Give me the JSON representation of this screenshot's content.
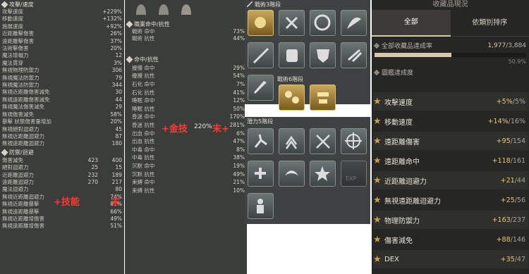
{
  "panel1": {
    "section_title": "攻擊/速度",
    "rows": [
      {
        "label": "攻擊速度",
        "value": "+229%"
      },
      {
        "label": "移動速度",
        "value": "+132%"
      },
      {
        "label": "施展速度",
        "value": "+92%"
      },
      {
        "label": "近距離擊傷害",
        "value": "26%"
      },
      {
        "label": "遠距離擊傷害",
        "value": "37%"
      },
      {
        "label": "法術擊傷害",
        "value": "20%"
      },
      {
        "label": "魔法增幅力",
        "value": "12"
      },
      {
        "label": "魔法貫穿",
        "value": "3%"
      },
      {
        "label": "無視物理防禦力",
        "value": "306"
      },
      {
        "label": "無視魔法防禦力",
        "value": "79"
      },
      {
        "label": "無視魔法防禦力",
        "value": "344"
      },
      {
        "label": "無視近距離傷害減免",
        "value": "30"
      },
      {
        "label": "無視遠距離傷害減免",
        "value": "44"
      },
      {
        "label": "無視魔法傷害減免",
        "value": "29"
      },
      {
        "label": "無視傷害減免",
        "value": "58%"
      },
      {
        "label": "暴擊 狀態傷害量增加",
        "value": "20%"
      },
      {
        "label": "無視絕對迴避力",
        "value": "45"
      },
      {
        "label": "無視近距離迴避力",
        "value": "87"
      },
      {
        "label": "無視遠距離迴避力",
        "value": "180"
      }
    ],
    "section2_title": "防禦/迴避",
    "rows2": [
      {
        "label": "傷害減免",
        "a": "423",
        "b": "400"
      },
      {
        "label": "絕對迴避力",
        "a": "25",
        "b": "15"
      },
      {
        "label": "近距離迴避力",
        "a": "232",
        "b": "189"
      },
      {
        "label": "遠距離迴避力",
        "a": "270",
        "b": "217"
      },
      {
        "label": "魔法迴避力",
        "a": "",
        "b": "80"
      },
      {
        "label": "無視近距離迴避力",
        "a": "",
        "b": "74%"
      },
      {
        "label": "無視近距離暴擊",
        "a": "",
        "b": "81%"
      },
      {
        "label": "無視遠距離暴擊",
        "a": "",
        "b": "66%"
      },
      {
        "label": "無視近距離增傷害",
        "a": "",
        "b": "49%"
      },
      {
        "label": "無視遠距離增傷害",
        "a": "",
        "b": "51%"
      }
    ],
    "red_label": "+技能",
    "red_end": "末"
  },
  "panel2": {
    "section_title": "職業命中/抗性",
    "rows": [
      {
        "label": "戰術 命中",
        "value": "73%"
      },
      {
        "label": "戰術 抗性",
        "value": "44%"
      }
    ],
    "section2_title": "命中/抗性",
    "rows2": [
      {
        "label": "擾攪 命中",
        "value": "29%"
      },
      {
        "label": "擾攪 抗性",
        "value": "54%"
      },
      {
        "label": "石化 命中",
        "value": "7%"
      },
      {
        "label": "石化 抗性",
        "value": "41%"
      },
      {
        "label": "睡眠 命中",
        "value": "12%"
      },
      {
        "label": "睡眠 抗性",
        "value": "50%"
      },
      {
        "label": "昏迷 命中",
        "value": "170%"
      },
      {
        "label": "昏迷 抗性",
        "value": "281%"
      },
      {
        "label": "出血 命中",
        "value": "6%"
      },
      {
        "label": "出血 抗性",
        "value": "47%"
      },
      {
        "label": "中毒 命中",
        "value": "8%"
      },
      {
        "label": "中毒 抗性",
        "value": "38%"
      },
      {
        "label": "沉默 命中",
        "value": "19%"
      },
      {
        "label": "沉默 抗性",
        "value": "49%"
      },
      {
        "label": "束縛 命中",
        "value": "21%"
      },
      {
        "label": "束縛 抗性",
        "value": "10%"
      }
    ],
    "red_label": "+金技",
    "red_pct": "220%",
    "red_end": "末+"
  },
  "panel3": {
    "title1": "戰術3階段",
    "title2": "戰術6階段",
    "title3": "潛力5階段",
    "exp_label": "EXP"
  },
  "panel4": {
    "title": "收藏品現況",
    "tabs": [
      {
        "label": "全部",
        "active": true
      },
      {
        "label": "依類別排序",
        "active": false
      }
    ],
    "rate_label": "全部收藏品達成率",
    "rate_value": "1,977",
    "rate_total": "/3,884",
    "rate_percent": "50.9%",
    "rate_fraction": 0.509,
    "section_title": "圖鑑達成度",
    "rows": [
      {
        "label": "攻擊速度",
        "cur": "+5%",
        "max": "/5%"
      },
      {
        "label": "移動速度",
        "cur": "+14%",
        "max": "/16%"
      },
      {
        "label": "遠距離傷害",
        "cur": "+95",
        "max": "/154"
      },
      {
        "label": "遠距離命中",
        "cur": "+118",
        "max": "/161"
      },
      {
        "label": "近距離迴避力",
        "cur": "+21",
        "max": "/44"
      },
      {
        "label": "無視遠距離迴避力",
        "cur": "+25",
        "max": "/56"
      },
      {
        "label": "物理防禦力",
        "cur": "+163",
        "max": "/237"
      },
      {
        "label": "傷害減免",
        "cur": "+88",
        "max": "/146"
      },
      {
        "label": "DEX",
        "cur": "+35",
        "max": "/47"
      }
    ]
  },
  "colors": {
    "gold": "#c8a050",
    "red": "#ff3b2f",
    "panel_bg": "#3a3c3a",
    "accent_bar": "#d8c8a8"
  }
}
